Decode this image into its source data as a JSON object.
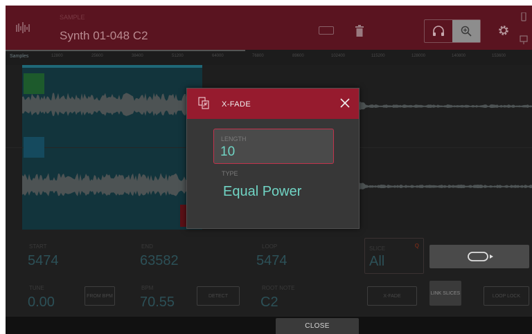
{
  "header": {
    "small_label": "SAMPLE",
    "sample_name": "Synth 01-048 C2"
  },
  "ruler": {
    "tag": "Samples",
    "ticks": [
      "12800",
      "25600",
      "38400",
      "51200",
      "64000",
      "76800",
      "89600",
      "102400",
      "115200",
      "128000",
      "140800",
      "153600"
    ]
  },
  "params": {
    "start_label": "START",
    "start_value": "5474",
    "end_label": "END",
    "end_value": "63582",
    "loop_label": "LOOP",
    "loop_value": "5474",
    "slice_label": "SLICE",
    "slice_value": "All",
    "slice_badge": "Q",
    "tune_label": "TUNE",
    "tune_value": "0.00",
    "from_bpm_label": "FROM BPM",
    "bpm_label": "BPM",
    "bpm_value": "70.55",
    "detect_label": "DETECT",
    "root_note_label": "ROOT NOTE",
    "root_note_value": "C2",
    "xfade_label": "X-FADE",
    "link_slices_label": "LINK SLICES",
    "loop_lock_label": "LOOP LOCK"
  },
  "footer": {
    "close_label": "CLOSE"
  },
  "modal": {
    "title": "X-FADE",
    "length_label": "LENGTH",
    "length_value": "10",
    "type_label": "TYPE",
    "type_value": "Equal Power"
  },
  "icons": {
    "waveform": "waveform-icon",
    "keyboard": "keyboard-icon",
    "trash": "trash-icon",
    "headphones": "headphones-icon",
    "zoom": "zoom-icon",
    "gear": "gear-icon",
    "loop": "loop-play-icon",
    "xfade": "xfade-icon",
    "close": "close-icon"
  },
  "colors": {
    "header_bg": "#5a1420",
    "modal_header": "#961b2e",
    "accent_teal": "#70d4c4",
    "field_border": "#c2334c"
  }
}
